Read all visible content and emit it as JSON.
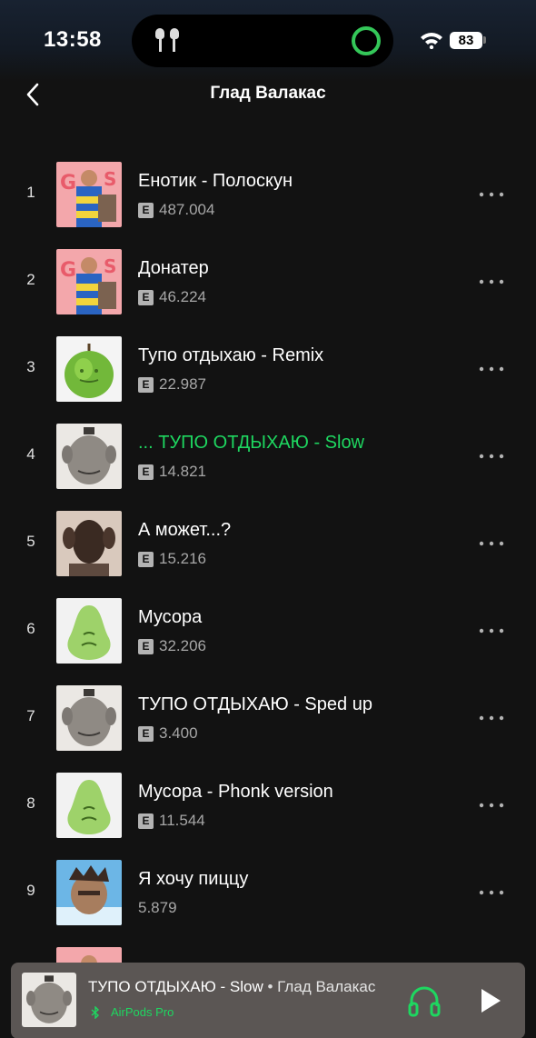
{
  "status_bar": {
    "time": "13:58",
    "battery": "83"
  },
  "header": {
    "title": "Глад Валакас"
  },
  "tracks": [
    {
      "num": "1",
      "title": "Енотик - Полоскун",
      "plays": "487.004",
      "explicit": "E",
      "cover": "pink"
    },
    {
      "num": "2",
      "title": "Донатер",
      "plays": "46.224",
      "explicit": "E",
      "cover": "pink"
    },
    {
      "num": "3",
      "title": "Тупо отдыхаю - Remix",
      "plays": "22.987",
      "explicit": "E",
      "cover": "apple"
    },
    {
      "num": "4",
      "title": "... ТУПО ОТДЫХАЮ - Slow",
      "plays": "14.821",
      "explicit": "E",
      "cover": "face",
      "active": true
    },
    {
      "num": "5",
      "title": "А может...?",
      "plays": "15.216",
      "explicit": "E",
      "cover": "portrait"
    },
    {
      "num": "6",
      "title": "Мусора",
      "plays": "32.206",
      "explicit": "E",
      "cover": "pear"
    },
    {
      "num": "7",
      "title": "ТУПО ОТДЫХАЮ - Sped up",
      "plays": "3.400",
      "explicit": "E",
      "cover": "face"
    },
    {
      "num": "8",
      "title": "Мусора - Phonk version",
      "plays": "11.544",
      "explicit": "E",
      "cover": "pear"
    },
    {
      "num": "9",
      "title": "Я хочу пиццу",
      "plays": "5.879",
      "explicit": "",
      "cover": "anime"
    }
  ],
  "now_playing": {
    "title": "ТУПО ОТДЫХАЮ - Slow",
    "separator": " • ",
    "artist": "Глад Валакас",
    "device": "AirPods Pro"
  },
  "colors": {
    "accent": "#1ed760",
    "background": "#121212",
    "player": "#5b5654"
  }
}
